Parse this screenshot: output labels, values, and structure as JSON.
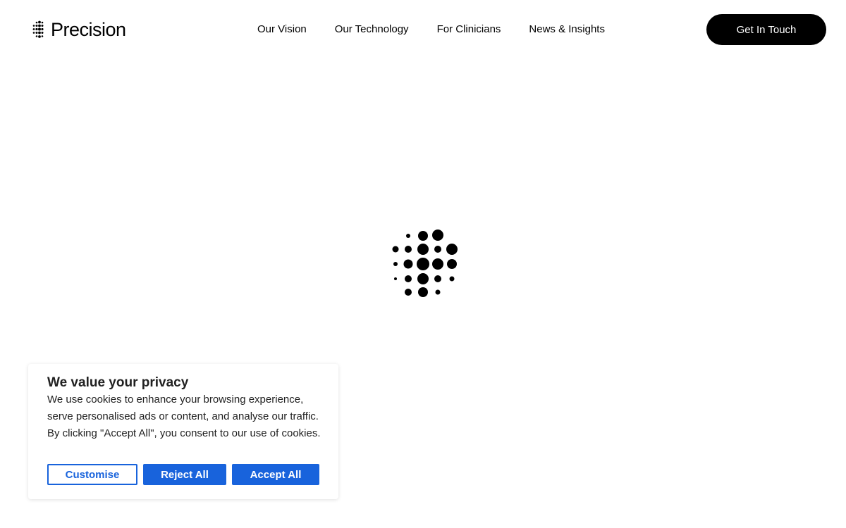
{
  "header": {
    "logo_text": "Precision",
    "logo_icon": "dot-grid-logo-icon",
    "nav": [
      {
        "label": "Our Vision"
      },
      {
        "label": "Our Technology"
      },
      {
        "label": "For Clinicians"
      },
      {
        "label": "News & Insights"
      }
    ],
    "cta_label": "Get In Touch"
  },
  "loader": {
    "icon": "dot-grid-loading-icon"
  },
  "cookie_banner": {
    "title": "We value your privacy",
    "body": "We use cookies to enhance your browsing experience, serve personalised ads or content, and analyse our traffic. By clicking \"Accept All\", you consent to our use of cookies.",
    "customise_label": "Customise",
    "reject_label": "Reject All",
    "accept_label": "Accept All",
    "accent_color": "#1863dc"
  }
}
